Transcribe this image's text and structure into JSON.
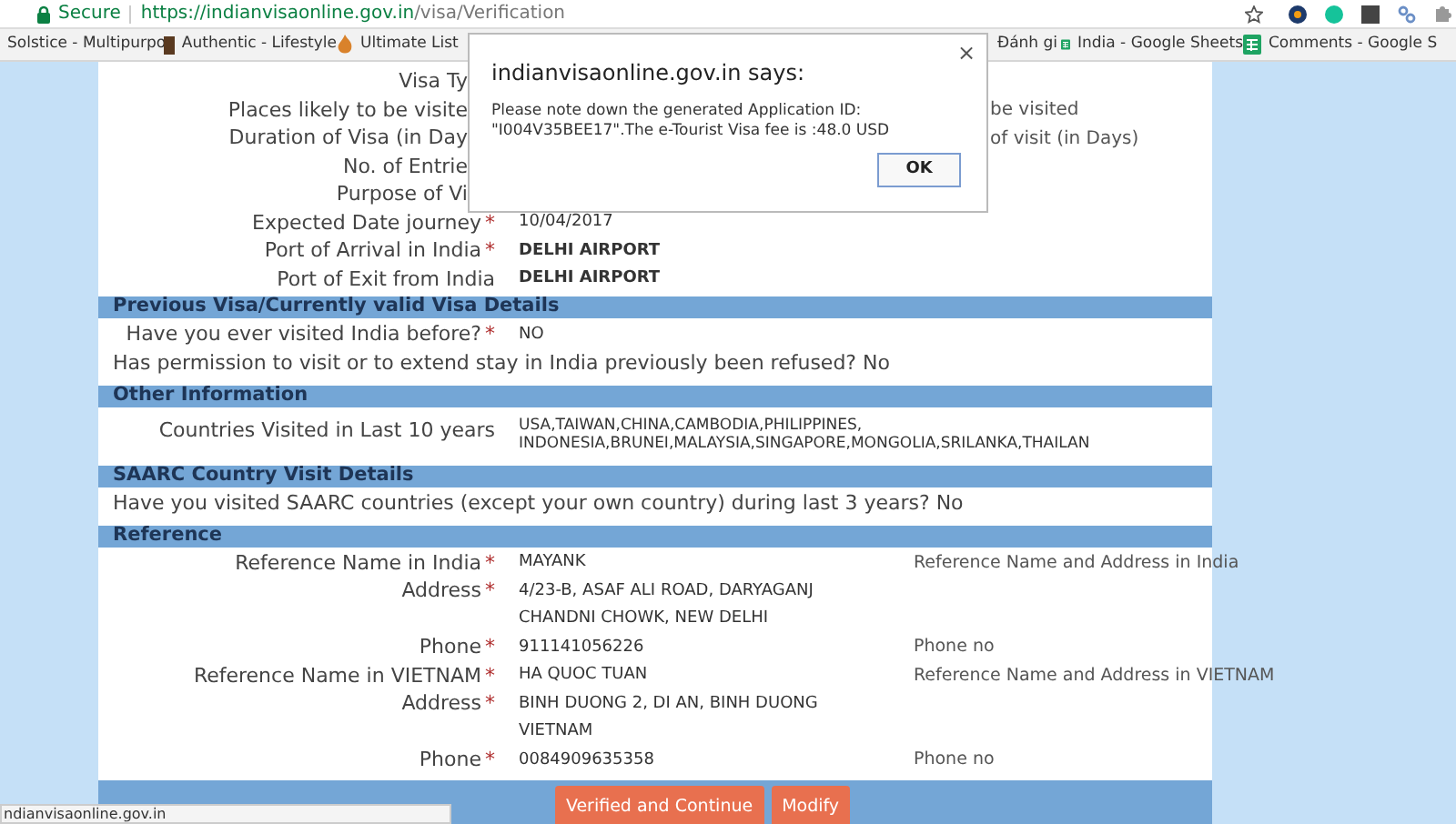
{
  "browser": {
    "secure": "Secure",
    "url_host": "https://indianvisaonline.gov.in",
    "url_path": "/visa/Verification",
    "bookmarks": [
      {
        "label": "Solstice - Multipurpo",
        "kind": "photo"
      },
      {
        "label": "Authentic - Lifestyle",
        "kind": "photo"
      },
      {
        "label": "Ultimate List",
        "kind": "flame"
      },
      {
        "label": "Đánh gi",
        "kind": "plain"
      },
      {
        "label": "India - Google Sheets",
        "kind": "sheet"
      },
      {
        "label": "Comments - Google S",
        "kind": "sheet"
      }
    ]
  },
  "form": {
    "top_rows": [
      {
        "kind": "partial",
        "label": "Visa Ty"
      },
      {
        "kind": "partial",
        "label": "Places likely to be visite",
        "hint": "be visited"
      },
      {
        "kind": "partial",
        "label": "Duration of Visa (in Day",
        "hint": "of visit (in Days)"
      },
      {
        "kind": "partial",
        "label": "No. of Entrie"
      },
      {
        "kind": "partial",
        "label": "Purpose of Vi"
      },
      {
        "kind": "field",
        "label": "Expected Date journey",
        "mark": "*",
        "value": "10/04/2017",
        "bold": false
      },
      {
        "kind": "field",
        "label": "Port of Arrival in India",
        "mark": "*",
        "value": "DELHI AIRPORT",
        "bold": true
      },
      {
        "kind": "field",
        "label": "Port of Exit from India",
        "value": "DELHI AIRPORT",
        "bold": true
      }
    ],
    "sections": [
      {
        "title": "Previous Visa/Currently valid Visa Details",
        "rows": [
          {
            "kind": "field",
            "label": "Have you ever visited India before?",
            "mark": "*",
            "value": "NO",
            "bold": false
          },
          {
            "kind": "question",
            "text": "Has permission to visit or to extend stay in India previously been refused? No"
          }
        ]
      },
      {
        "title": "Other Information",
        "rows": [
          {
            "kind": "multiline",
            "label": "Countries Visited in Last 10 years",
            "lines": [
              "USA,TAIWAN,CHINA,CAMBODIA,PHILIPPINES,",
              "INDONESIA,BRUNEI,MALAYSIA,SINGAPORE,MONGOLIA,SRILANKA,THAILAN"
            ]
          }
        ]
      },
      {
        "title": "SAARC Country Visit Details",
        "rows": [
          {
            "kind": "question",
            "text": "Have you visited SAARC countries (except your own country) during last 3 years? No"
          }
        ]
      },
      {
        "title": "Reference",
        "rows": [
          {
            "kind": "field",
            "label": "Reference Name in India",
            "mark": "*",
            "value": "MAYANK",
            "bold": false,
            "hint": "Reference Name and Address in India"
          },
          {
            "kind": "field",
            "label": "Address",
            "mark": "*",
            "value": "4/23-B, ASAF ALI ROAD, DARYAGANJ",
            "bold": false
          },
          {
            "kind": "field",
            "value": "CHANDNI CHOWK, NEW DELHI",
            "bold": false
          },
          {
            "kind": "field",
            "label": "Phone",
            "mark": "*",
            "value": "911141056226",
            "bold": false,
            "hint": "Phone no"
          },
          {
            "kind": "field",
            "label": "Reference Name in VIETNAM",
            "mark": "*",
            "value": "HA QUOC TUAN",
            "bold": false,
            "hint": "Reference Name and Address in VIETNAM"
          },
          {
            "kind": "field",
            "label": "Address",
            "mark": "*",
            "value": "BINH DUONG 2, DI AN, BINH DUONG",
            "bold": false
          },
          {
            "kind": "field",
            "value": "VIETNAM",
            "bold": false
          },
          {
            "kind": "field",
            "label": "Phone",
            "mark": "*",
            "value": "0084909635358",
            "bold": false,
            "hint": "Phone no"
          }
        ]
      }
    ],
    "buttons": [
      "Verified and Continue",
      "Modify"
    ]
  },
  "dialog": {
    "title": "indianvisaonline.gov.in says:",
    "close": "×",
    "message": "Please note down the generated Application ID: \"I004V35BEE17\".The e-Tourist Visa fee is :48.0 USD",
    "ok": "OK"
  },
  "status_bar": "ndianvisaonline.gov.in"
}
